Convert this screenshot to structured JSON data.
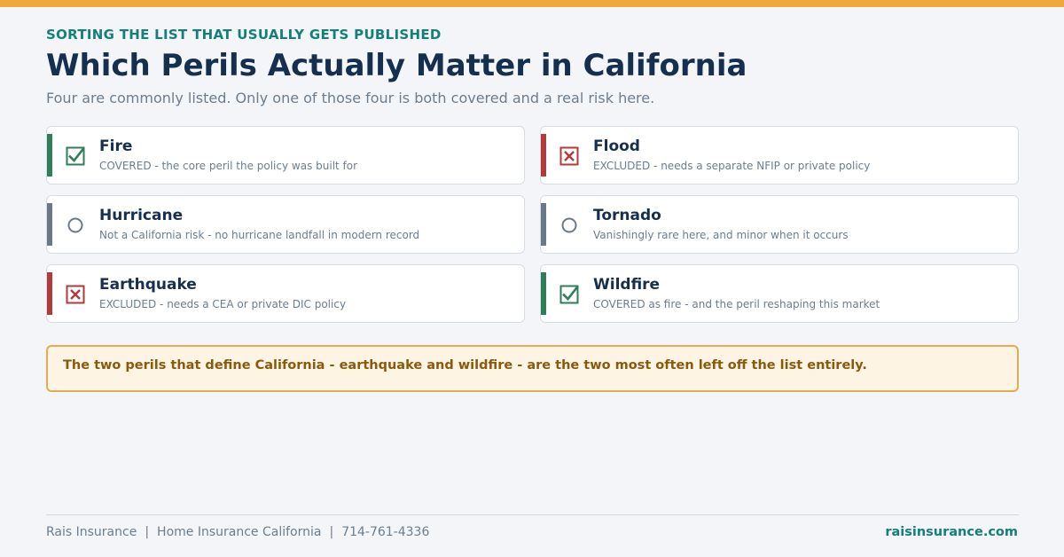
{
  "header": {
    "eyebrow": "SORTING THE LIST THAT USUALLY GETS PUBLISHED",
    "title": "Which Perils Actually Matter in California",
    "subtitle": "Four are commonly listed. Only one of those four is both covered and a real risk here."
  },
  "colors": {
    "covered": "#2e7d5b",
    "excluded": "#b23a3a",
    "not_a_risk": "#6b7888",
    "accent_bar": "#f0a83a",
    "brand_teal": "#14807a",
    "navy": "#15304f"
  },
  "perils": [
    {
      "name": "Fire",
      "status": "covered",
      "icon": "checkbox-checked-icon",
      "description": "COVERED - the core peril the policy was built for"
    },
    {
      "name": "Flood",
      "status": "excluded",
      "icon": "checkbox-x-icon",
      "description": "EXCLUDED - needs a separate NFIP or private policy"
    },
    {
      "name": "Hurricane",
      "status": "not_a_risk",
      "icon": "circle-icon",
      "description": "Not a California risk - no hurricane landfall in modern record"
    },
    {
      "name": "Tornado",
      "status": "not_a_risk",
      "icon": "circle-icon",
      "description": "Vanishingly rare here, and minor when it occurs"
    },
    {
      "name": "Earthquake",
      "status": "excluded",
      "icon": "checkbox-x-icon",
      "description": "EXCLUDED - needs a CEA or private DIC policy"
    },
    {
      "name": "Wildfire",
      "status": "covered",
      "icon": "checkbox-checked-icon",
      "description": "COVERED as fire - and the peril reshaping this market"
    }
  ],
  "callout": {
    "text": "The two perils that define California - earthquake and wildfire - are the two most often left off the list entirely."
  },
  "footer": {
    "company": "Rais Insurance",
    "separator": "|",
    "product": "Home Insurance California",
    "phone": "714-761-4336",
    "website": "raisinsurance.com"
  }
}
